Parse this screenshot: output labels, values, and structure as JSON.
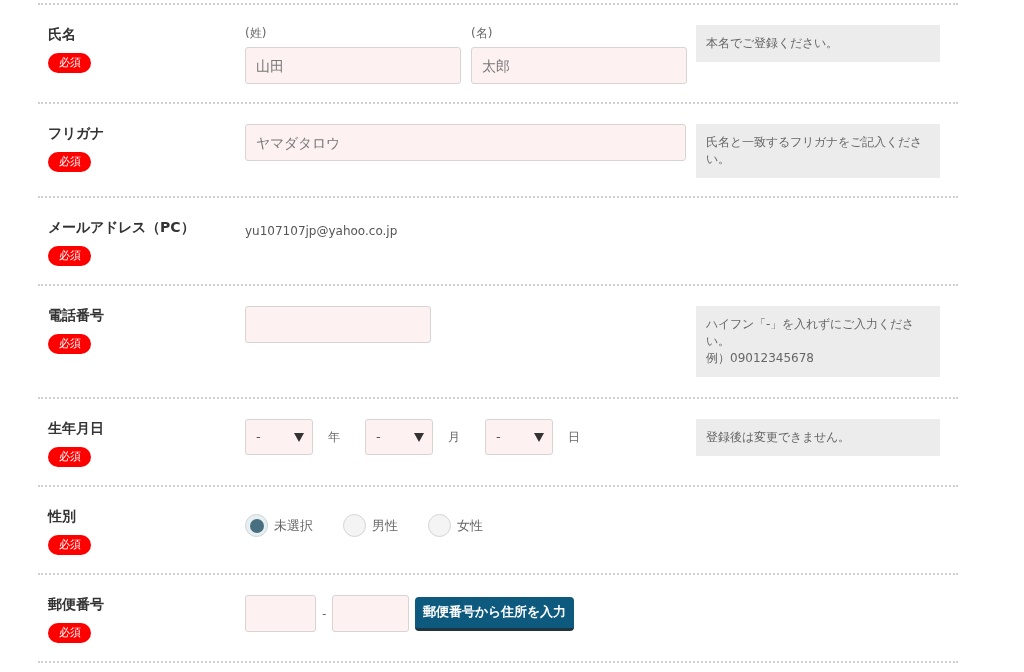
{
  "rows": [
    {
      "kind": "name",
      "label": "氏名",
      "badge": "必須",
      "fields": [
        {
          "sublabel": "(姓)",
          "placeholder": "山田"
        },
        {
          "sublabel": "(名)",
          "placeholder": "太郎"
        }
      ],
      "note": [
        "本名でご登録ください。"
      ]
    },
    {
      "kind": "text",
      "label": "フリガナ",
      "badge": "必須",
      "placeholder": "ヤマダタロウ",
      "note": [
        "氏名と一致するフリガナをご記入ください。"
      ]
    },
    {
      "kind": "static",
      "label": "メールアドレス（PC）",
      "badge": "必須",
      "value": "yu107107jp@yahoo.co.jp"
    },
    {
      "kind": "phone",
      "label": "電話番号",
      "badge": "必須",
      "note": [
        "ハイフン「-」を入れずにご入力ください。",
        "例）09012345678"
      ]
    },
    {
      "kind": "date",
      "label": "生年月日",
      "badge": "必須",
      "selects": [
        {
          "value": "-",
          "unit": "年"
        },
        {
          "value": "-",
          "unit": "月"
        },
        {
          "value": "-",
          "unit": "日"
        }
      ],
      "note": [
        "登録後は変更できません。"
      ]
    },
    {
      "kind": "radio",
      "label": "性別",
      "badge": "必須",
      "options": [
        {
          "label": "未選択",
          "selected": true
        },
        {
          "label": "男性",
          "selected": false
        },
        {
          "label": "女性",
          "selected": false
        }
      ]
    },
    {
      "kind": "postal",
      "label": "郵便番号",
      "badge": "必須",
      "separator": "-",
      "button": "郵便番号から住所を入力"
    }
  ]
}
